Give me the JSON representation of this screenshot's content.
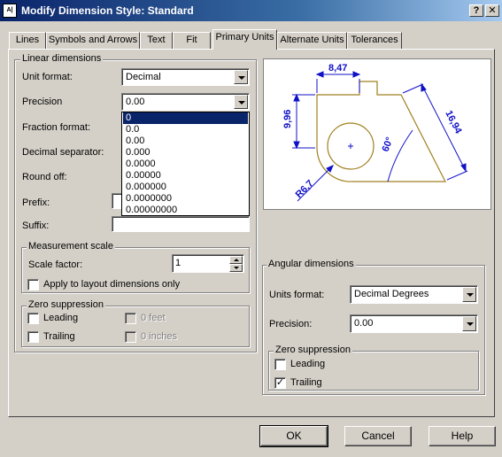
{
  "window": {
    "title": "Modify Dimension Style: Standard",
    "icon_text": "A|",
    "help_btn": "?",
    "close_btn": "✕"
  },
  "tabs": [
    {
      "label": "Lines"
    },
    {
      "label": "Symbols and Arrows"
    },
    {
      "label": "Text"
    },
    {
      "label": "Fit"
    },
    {
      "label": "Primary Units",
      "active": true
    },
    {
      "label": "Alternate Units"
    },
    {
      "label": "Tolerances"
    }
  ],
  "linear": {
    "group_title": "Linear dimensions",
    "unit_format_label": "Unit format:",
    "unit_format_value": "Decimal",
    "precision_label": "Precision",
    "precision_value": "0.00",
    "precision_options": [
      "0",
      "0.0",
      "0.00",
      "0.000",
      "0.0000",
      "0.00000",
      "0.000000",
      "0.0000000",
      "0.00000000"
    ],
    "precision_highlighted": "0",
    "fraction_format_label": "Fraction format:",
    "decimal_separator_label": "Decimal separator:",
    "round_off_label": "Round off:",
    "prefix_label": "Prefix:",
    "suffix_label": "Suffix:"
  },
  "measurement": {
    "group_title": "Measurement scale",
    "scale_factor_label": "Scale factor:",
    "scale_factor_value": "1",
    "apply_layout_label": "Apply to layout dimensions only",
    "apply_layout_checked": false
  },
  "zero_linear": {
    "group_title": "Zero suppression",
    "leading_label": "Leading",
    "trailing_label": "Trailing",
    "feet_label": "0 feet",
    "inches_label": "0 inches",
    "leading_checked": false,
    "trailing_checked": false
  },
  "preview": {
    "dim_top": "8,47",
    "dim_left": "9,96",
    "dim_diag": "16,94",
    "angle": "60°",
    "radius": "R6,7",
    "line_color": "#1010c8",
    "geometry_color": "#a08020"
  },
  "angular": {
    "group_title": "Angular dimensions",
    "units_format_label": "Units format:",
    "units_format_value": "Decimal Degrees",
    "precision_label": "Precision:",
    "precision_value": "0.00",
    "zero_group_title": "Zero suppression",
    "leading_label": "Leading",
    "trailing_label": "Trailing",
    "leading_checked": false,
    "trailing_checked": true,
    "check_mark": "✓"
  },
  "buttons": {
    "ok": "OK",
    "cancel": "Cancel",
    "help": "Help"
  }
}
